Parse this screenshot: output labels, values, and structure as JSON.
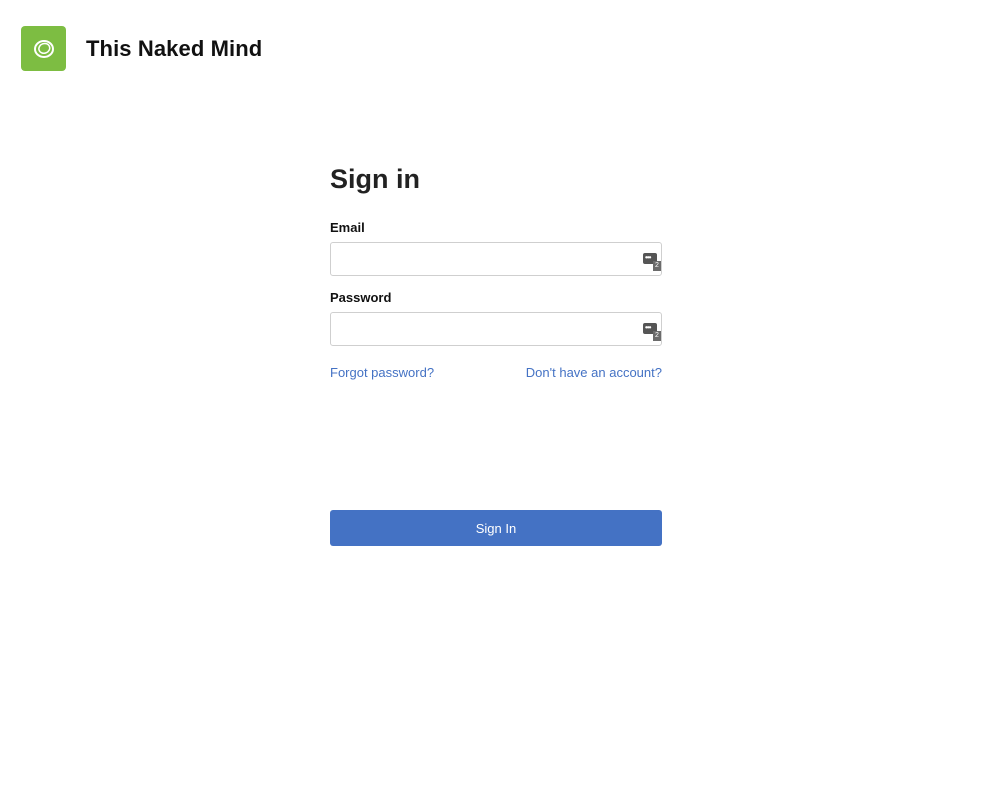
{
  "header": {
    "brand_name": "This Naked Mind",
    "logo_icon": "circle-swirl-logo",
    "logo_color": "#7dbd42"
  },
  "form": {
    "title": "Sign in",
    "email_label": "Email",
    "email_value": "",
    "email_placeholder": "",
    "password_label": "Password",
    "password_value": "",
    "password_placeholder": "",
    "password_manager_icon": "password-manager-icon",
    "password_manager_count": "2",
    "forgot_password_link": "Forgot password?",
    "signup_link": "Don't have an account?",
    "submit_label": "Sign In",
    "accent_color": "#4472c4"
  }
}
